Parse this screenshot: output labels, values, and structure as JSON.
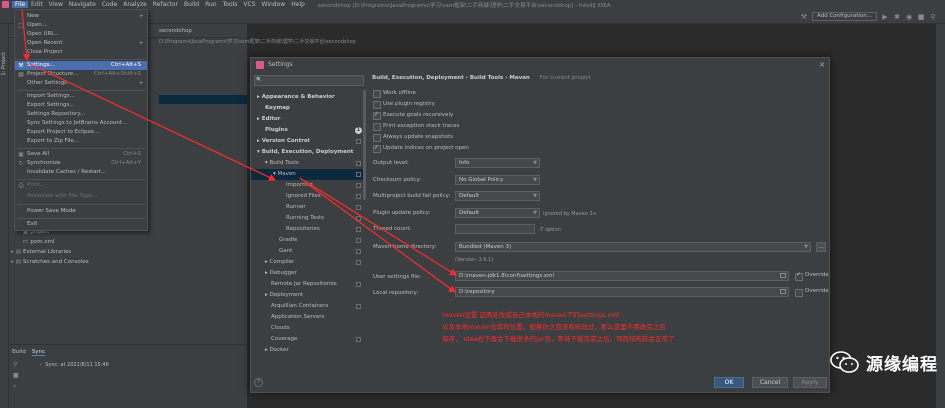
{
  "menubar": {
    "items": [
      "File",
      "Edit",
      "View",
      "Navigate",
      "Code",
      "Analyze",
      "Refactor",
      "Build",
      "Run",
      "Tools",
      "VCS",
      "Window",
      "Help"
    ],
    "title": "secondshop [D:\\Programs\\JavaPrograms\\学习\\ssm框架\\二手商城\\理学\\二手交易平台\\secondshop] - IntelliJ IDEA"
  },
  "toolbar": {
    "add_config": "Add Configuration..."
  },
  "left_strip": {
    "project_label": "1: Project"
  },
  "project": {
    "header": "secondshop",
    "path": "D:\\Programs\\JavaPrograms\\学习\\ssm框架\\二手商城\\理学\\二手交易平台\\secondshop",
    "tree": [
      {
        "label": "project"
      },
      {
        "label": "pom.xml"
      },
      {
        "label": "External Libraries"
      },
      {
        "label": "Scratches and Consoles"
      }
    ]
  },
  "file_menu": {
    "items": [
      {
        "label": "New",
        "shortcut": "",
        "submenu": true
      },
      {
        "label": "Open...",
        "shortcut": ""
      },
      {
        "label": "Open URL...",
        "shortcut": ""
      },
      {
        "label": "Open Recent",
        "shortcut": "",
        "submenu": true
      },
      {
        "label": "Close Project",
        "shortcut": ""
      },
      {
        "label": "Settings...",
        "shortcut": "Ctrl+Alt+S"
      },
      {
        "label": "Project Structure...",
        "shortcut": "Ctrl+Alt+Shift+S"
      },
      {
        "label": "Other Settings",
        "shortcut": "",
        "submenu": true
      },
      {
        "label": "Import Settings...",
        "shortcut": ""
      },
      {
        "label": "Export Settings...",
        "shortcut": ""
      },
      {
        "label": "Settings Repository...",
        "shortcut": ""
      },
      {
        "label": "Sync Settings to JetBrains Account...",
        "shortcut": ""
      },
      {
        "label": "Export Project to Eclipse...",
        "shortcut": ""
      },
      {
        "label": "Export to Zip File...",
        "shortcut": ""
      },
      {
        "label": "Save All",
        "shortcut": "Ctrl+S"
      },
      {
        "label": "Synchronize",
        "shortcut": "Ctrl+Alt+Y"
      },
      {
        "label": "Invalidate Caches / Restart...",
        "shortcut": ""
      },
      {
        "label": "Print...",
        "shortcut": ""
      },
      {
        "label": "Associate with File Type...",
        "shortcut": ""
      },
      {
        "label": "Power Save Mode",
        "shortcut": ""
      },
      {
        "label": "Exit",
        "shortcut": ""
      }
    ]
  },
  "bottom_panel": {
    "tabs": [
      "Build",
      "Sync"
    ],
    "sync_line": "Sync: at 2021/8/11 15:46"
  },
  "settings": {
    "title": "Settings",
    "search_placeholder": "",
    "tree": [
      {
        "label": "Appearance & Behavior",
        "bold": true,
        "arrow": "▸"
      },
      {
        "label": "Keymap",
        "bold": true,
        "arrow": ""
      },
      {
        "label": "Editor",
        "bold": true,
        "arrow": "▸"
      },
      {
        "label": "Plugins",
        "bold": true,
        "arrow": ""
      },
      {
        "label": "Version Control",
        "bold": true,
        "arrow": "▸"
      },
      {
        "label": "Build, Execution, Deployment",
        "bold": true,
        "arrow": "▾"
      },
      {
        "label": "Build Tools",
        "bold": false,
        "arrow": "▾"
      },
      {
        "label": "Maven",
        "bold": false,
        "arrow": "▾"
      },
      {
        "label": "Importing",
        "bold": false,
        "arrow": ""
      },
      {
        "label": "Ignored Files",
        "bold": false,
        "arrow": ""
      },
      {
        "label": "Runner",
        "bold": false,
        "arrow": ""
      },
      {
        "label": "Running Tests",
        "bold": false,
        "arrow": ""
      },
      {
        "label": "Repositories",
        "bold": false,
        "arrow": ""
      },
      {
        "label": "Gradle",
        "bold": false,
        "arrow": ""
      },
      {
        "label": "Gant",
        "bold": false,
        "arrow": ""
      },
      {
        "label": "Compiler",
        "bold": false,
        "arrow": "▸"
      },
      {
        "label": "Debugger",
        "bold": false,
        "arrow": "▸"
      },
      {
        "label": "Remote Jar Repositories",
        "bold": false,
        "arrow": ""
      },
      {
        "label": "Deployment",
        "bold": false,
        "arrow": "▸"
      },
      {
        "label": "Arquillian Containers",
        "bold": false,
        "arrow": ""
      },
      {
        "label": "Application Servers",
        "bold": false,
        "arrow": ""
      },
      {
        "label": "Clouds",
        "bold": false,
        "arrow": ""
      },
      {
        "label": "Coverage",
        "bold": false,
        "arrow": ""
      },
      {
        "label": "Docker",
        "bold": false,
        "arrow": "▸"
      }
    ],
    "plugins_badge": "1",
    "breadcrumb": [
      "Build, Execution, Deployment",
      "Build Tools",
      "Maven"
    ],
    "for_current_project": "For current project",
    "checkboxes": [
      {
        "label": "Work offline",
        "checked": false
      },
      {
        "label": "Use plugin registry",
        "checked": false
      },
      {
        "label": "Execute goals recursively",
        "checked": true
      },
      {
        "label": "Print exception stack traces",
        "checked": false
      },
      {
        "label": "Always update snapshots",
        "checked": false
      },
      {
        "label": "Update indices on project open",
        "checked": true
      }
    ],
    "fields": {
      "output_level": {
        "label": "Output level:",
        "value": "Info"
      },
      "checksum_policy": {
        "label": "Checksum policy:",
        "value": "No Global Policy"
      },
      "multiproject_fail": {
        "label": "Multiproject build fail policy:",
        "value": "Default"
      },
      "plugin_update": {
        "label": "Plugin update policy:",
        "value": "Default",
        "hint": "ignored by Maven 3+"
      },
      "thread_count": {
        "label": "Thread count:",
        "value": "",
        "hint": "-T option"
      },
      "maven_home": {
        "label": "Maven home directory:",
        "value": "Bundled (Maven 3)",
        "version": "(Version: 3.6.1)"
      },
      "user_settings": {
        "label": "User settings file:",
        "value": "D:\\maven-jdk1.8\\conf\\settings.xml",
        "override_label": "Override",
        "override_checked": true
      },
      "local_repo": {
        "label": "Local repository:",
        "value": "D:\\repository",
        "override_label": "Override",
        "override_checked": false
      }
    },
    "annotation": [
      "maven设置    这两处改成自己本地的maven下的settings.xml",
      "以及本地maven仓库的位置，如果你之前没有修改过，那么这里不用改完之后",
      "保存， idea右下角会下载很多的jar包，等待下载完成之后，项目结构就会正常了"
    ],
    "buttons": {
      "ok": "OK",
      "cancel": "Cancel",
      "apply": "Apply",
      "help": "?"
    }
  },
  "watermark": {
    "text": "源缘编程"
  },
  "colors": {
    "accent": "#4b6eaf",
    "annotation": "#ff2a2a",
    "ok_button": "#365880",
    "background": "#2b2b2b"
  }
}
